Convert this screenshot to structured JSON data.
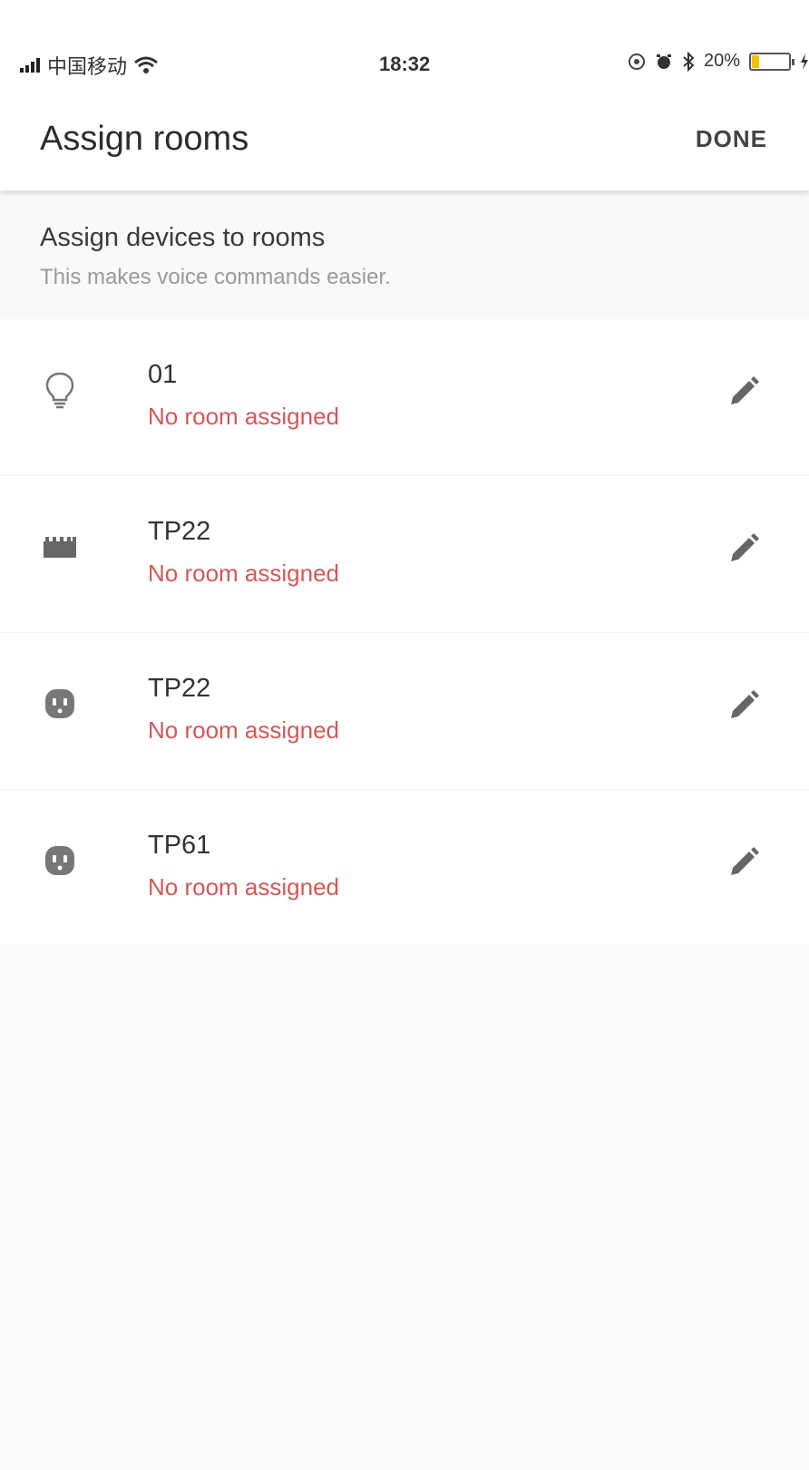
{
  "status_bar": {
    "carrier": "中国移动",
    "time": "18:32",
    "battery_percent_label": "20%",
    "battery_level": 0.2
  },
  "app_bar": {
    "title": "Assign rooms",
    "done_label": "DONE"
  },
  "intro": {
    "title": "Assign devices to rooms",
    "subtitle": "This makes voice commands easier."
  },
  "devices": [
    {
      "name": "01",
      "status": "No room assigned",
      "icon": "lightbulb-icon"
    },
    {
      "name": "TP22",
      "status": "No room assigned",
      "icon": "light-strip-icon"
    },
    {
      "name": "TP22",
      "status": "No room assigned",
      "icon": "smart-plug-icon"
    },
    {
      "name": "TP61",
      "status": "No room assigned",
      "icon": "smart-plug-icon"
    }
  ],
  "colors": {
    "status_red": "#d45757",
    "icon_gray": "#777777",
    "battery_yellow": "#f2c200"
  }
}
